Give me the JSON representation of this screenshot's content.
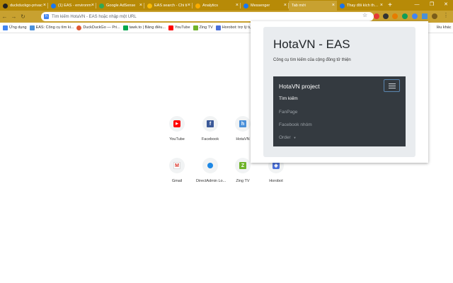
{
  "tabs": [
    {
      "title": "duckduckgo-privac",
      "color": "#222222"
    },
    {
      "title": "(1) EAS - environm",
      "color": "#1877f2"
    },
    {
      "title": "Google AdSense",
      "color": "#34a853"
    },
    {
      "title": "EAS search - Chi ti",
      "color": "#fbbc04"
    },
    {
      "title": "Analytics",
      "color": "#f9ab00"
    },
    {
      "title": "Messenger",
      "color": "#1877f2"
    },
    {
      "title": "Tab mới",
      "color": ""
    },
    {
      "title": "Thay đổi kích thước",
      "color": "#1a73e8"
    }
  ],
  "omnibox": {
    "text": "Tìm kiếm HotaVN - EAS hoặc nhập một URL"
  },
  "bookmarks": [
    {
      "label": "Ứng dụng",
      "color": "#4285f4"
    },
    {
      "label": "EAS: Công cụ tìm ki...",
      "color": "#4a90d9"
    },
    {
      "label": "DuckDuckGo — Pri...",
      "color": "#de5833"
    },
    {
      "label": "tawk.to | Bảng điều...",
      "color": "#03a84e"
    },
    {
      "label": "YouTube",
      "color": "#ff0000"
    },
    {
      "label": "Zing TV",
      "color": "#6fb32a"
    },
    {
      "label": "Horobot: trợ lý tự đ",
      "color": "#4a6fd8"
    }
  ],
  "bookmarks_overflow": "lều khác",
  "shortcuts": [
    {
      "label": "YouTube",
      "glyph": "▶",
      "color": "#ff0000"
    },
    {
      "label": "Facebook",
      "glyph": "f",
      "color": "#3b5998"
    },
    {
      "label": "HotaVN",
      "glyph": "h",
      "color": "#4a90d9"
    },
    {
      "label": "Gmail",
      "glyph": "M",
      "color": "#d93025"
    },
    {
      "label": "DirectAdmin Lo...",
      "glyph": "●",
      "color": "#1e88e5"
    },
    {
      "label": "Zing TV",
      "glyph": "Z",
      "color": "#6fb32a"
    },
    {
      "label": "Horobot",
      "glyph": "◈",
      "color": "#4a6fd8"
    }
  ],
  "popup": {
    "title": "HotaVN - EAS",
    "subtitle": "Công cụ tìm kiếm của cộng đồng tử thiện",
    "navbar": {
      "brand": "HotaVN project",
      "links": [
        "Tìm kiếm",
        "FanPage",
        "Facebook nhóm",
        "Order"
      ]
    }
  }
}
